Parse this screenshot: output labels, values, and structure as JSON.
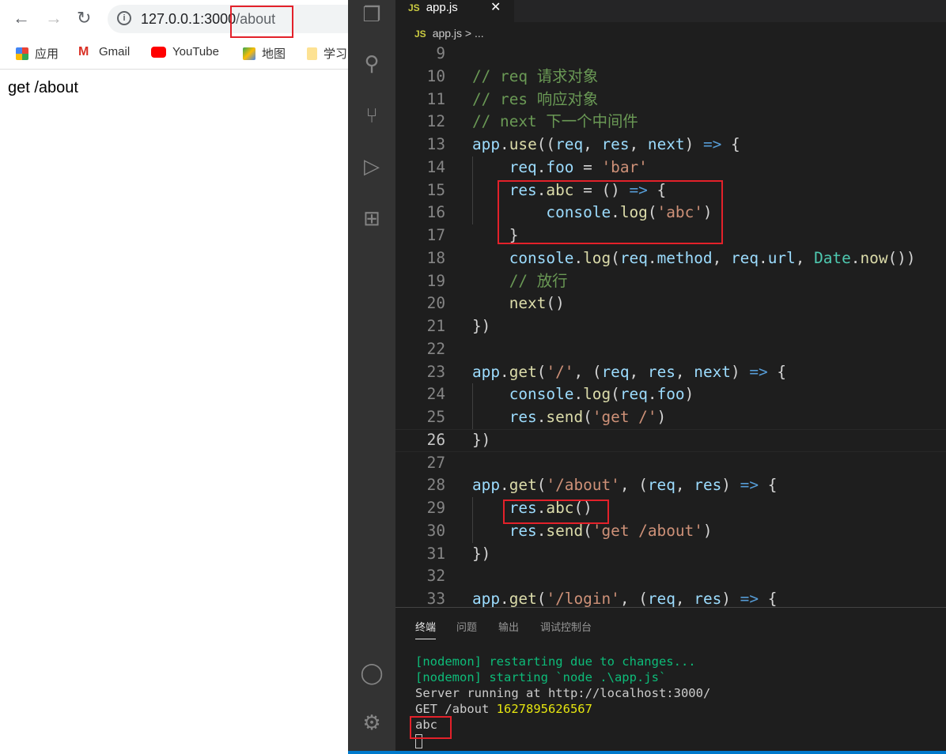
{
  "browser": {
    "url_host": "127.0.0.1:3000",
    "url_path": "/about",
    "bookmarks": [
      {
        "label": "应用",
        "icon": "apps-grid-icon"
      },
      {
        "label": "Gmail",
        "icon": "gmail-icon"
      },
      {
        "label": "YouTube",
        "icon": "youtube-icon"
      },
      {
        "label": "地图",
        "icon": "maps-icon"
      },
      {
        "label": "学习",
        "icon": "folder-icon"
      }
    ],
    "page_text": "get /about"
  },
  "editor": {
    "tab_label": "app.js",
    "tab_badge": "JS",
    "breadcrumb": "app.js > ...",
    "current_line": 26,
    "lines": [
      {
        "n": 9,
        "t": []
      },
      {
        "n": 10,
        "t": [
          [
            "cmt",
            "// req 请求对象"
          ]
        ]
      },
      {
        "n": 11,
        "t": [
          [
            "cmt",
            "// res 响应对象"
          ]
        ]
      },
      {
        "n": 12,
        "t": [
          [
            "cmt",
            "// next 下一个中间件"
          ]
        ]
      },
      {
        "n": 13,
        "t": [
          [
            "var",
            "app"
          ],
          [
            "pun",
            "."
          ],
          [
            "fn",
            "use"
          ],
          [
            "pun",
            "(("
          ],
          [
            "var",
            "req"
          ],
          [
            "pun",
            ", "
          ],
          [
            "var",
            "res"
          ],
          [
            "pun",
            ", "
          ],
          [
            "var",
            "next"
          ],
          [
            "pun",
            ") "
          ],
          [
            "kw",
            "=>"
          ],
          [
            "pun",
            " {"
          ]
        ]
      },
      {
        "n": 14,
        "t": [
          [
            "pun",
            "    "
          ],
          [
            "var",
            "req"
          ],
          [
            "pun",
            "."
          ],
          [
            "var",
            "foo"
          ],
          [
            "pun",
            " = "
          ],
          [
            "str",
            "'bar'"
          ]
        ]
      },
      {
        "n": 15,
        "t": [
          [
            "pun",
            "    "
          ],
          [
            "var",
            "res"
          ],
          [
            "pun",
            "."
          ],
          [
            "fn",
            "abc"
          ],
          [
            "pun",
            " = () "
          ],
          [
            "kw",
            "=>"
          ],
          [
            "pun",
            " {"
          ]
        ]
      },
      {
        "n": 16,
        "t": [
          [
            "pun",
            "        "
          ],
          [
            "var",
            "console"
          ],
          [
            "pun",
            "."
          ],
          [
            "fn",
            "log"
          ],
          [
            "pun",
            "("
          ],
          [
            "str",
            "'abc'"
          ],
          [
            "pun",
            ")"
          ]
        ]
      },
      {
        "n": 17,
        "t": [
          [
            "pun",
            "    }"
          ]
        ]
      },
      {
        "n": 18,
        "t": [
          [
            "pun",
            "    "
          ],
          [
            "var",
            "console"
          ],
          [
            "pun",
            "."
          ],
          [
            "fn",
            "log"
          ],
          [
            "pun",
            "("
          ],
          [
            "var",
            "req"
          ],
          [
            "pun",
            "."
          ],
          [
            "var",
            "method"
          ],
          [
            "pun",
            ", "
          ],
          [
            "var",
            "req"
          ],
          [
            "pun",
            "."
          ],
          [
            "var",
            "url"
          ],
          [
            "pun",
            ", "
          ],
          [
            "cls",
            "Date"
          ],
          [
            "pun",
            "."
          ],
          [
            "fn",
            "now"
          ],
          [
            "pun",
            "())"
          ]
        ]
      },
      {
        "n": 19,
        "t": [
          [
            "pun",
            "    "
          ],
          [
            "cmt",
            "// 放行"
          ]
        ]
      },
      {
        "n": 20,
        "t": [
          [
            "pun",
            "    "
          ],
          [
            "fn",
            "next"
          ],
          [
            "pun",
            "()"
          ]
        ]
      },
      {
        "n": 21,
        "t": [
          [
            "pun",
            "})"
          ]
        ]
      },
      {
        "n": 22,
        "t": []
      },
      {
        "n": 23,
        "t": [
          [
            "var",
            "app"
          ],
          [
            "pun",
            "."
          ],
          [
            "fn",
            "get"
          ],
          [
            "pun",
            "("
          ],
          [
            "str",
            "'/'"
          ],
          [
            "pun",
            ", ("
          ],
          [
            "var",
            "req"
          ],
          [
            "pun",
            ", "
          ],
          [
            "var",
            "res"
          ],
          [
            "pun",
            ", "
          ],
          [
            "var",
            "next"
          ],
          [
            "pun",
            ") "
          ],
          [
            "kw",
            "=>"
          ],
          [
            "pun",
            " {"
          ]
        ]
      },
      {
        "n": 24,
        "t": [
          [
            "pun",
            "    "
          ],
          [
            "var",
            "console"
          ],
          [
            "pun",
            "."
          ],
          [
            "fn",
            "log"
          ],
          [
            "pun",
            "("
          ],
          [
            "var",
            "req"
          ],
          [
            "pun",
            "."
          ],
          [
            "var",
            "foo"
          ],
          [
            "pun",
            ")"
          ]
        ]
      },
      {
        "n": 25,
        "t": [
          [
            "pun",
            "    "
          ],
          [
            "var",
            "res"
          ],
          [
            "pun",
            "."
          ],
          [
            "fn",
            "send"
          ],
          [
            "pun",
            "("
          ],
          [
            "str",
            "'get /'"
          ],
          [
            "pun",
            ")"
          ]
        ]
      },
      {
        "n": 26,
        "t": [
          [
            "pun",
            "})"
          ]
        ]
      },
      {
        "n": 27,
        "t": []
      },
      {
        "n": 28,
        "t": [
          [
            "var",
            "app"
          ],
          [
            "pun",
            "."
          ],
          [
            "fn",
            "get"
          ],
          [
            "pun",
            "("
          ],
          [
            "str",
            "'/about'"
          ],
          [
            "pun",
            ", ("
          ],
          [
            "var",
            "req"
          ],
          [
            "pun",
            ", "
          ],
          [
            "var",
            "res"
          ],
          [
            "pun",
            ") "
          ],
          [
            "kw",
            "=>"
          ],
          [
            "pun",
            " {"
          ]
        ]
      },
      {
        "n": 29,
        "t": [
          [
            "pun",
            "    "
          ],
          [
            "var",
            "res"
          ],
          [
            "pun",
            "."
          ],
          [
            "fn",
            "abc"
          ],
          [
            "pun",
            "()"
          ]
        ]
      },
      {
        "n": 30,
        "t": [
          [
            "pun",
            "    "
          ],
          [
            "var",
            "res"
          ],
          [
            "pun",
            "."
          ],
          [
            "fn",
            "send"
          ],
          [
            "pun",
            "("
          ],
          [
            "str",
            "'get /about'"
          ],
          [
            "pun",
            ")"
          ]
        ]
      },
      {
        "n": 31,
        "t": [
          [
            "pun",
            "})"
          ]
        ]
      },
      {
        "n": 32,
        "t": []
      },
      {
        "n": 33,
        "t": [
          [
            "var",
            "app"
          ],
          [
            "pun",
            "."
          ],
          [
            "fn",
            "get"
          ],
          [
            "pun",
            "("
          ],
          [
            "str",
            "'/login'"
          ],
          [
            "pun",
            ", ("
          ],
          [
            "var",
            "req"
          ],
          [
            "pun",
            ", "
          ],
          [
            "var",
            "res"
          ],
          [
            "pun",
            ") "
          ],
          [
            "kw",
            "=>"
          ],
          [
            "pun",
            " {"
          ]
        ]
      }
    ]
  },
  "panel": {
    "tabs": [
      "终端",
      "问题",
      "输出",
      "调试控制台"
    ],
    "terminal": {
      "line1": "[nodemon] restarting due to changes...",
      "line2": "[nodemon] starting `node .\\app.js`",
      "line3": "Server running at http://localhost:3000/",
      "line4_prefix": "GET /about ",
      "line4_time": "1627895626567",
      "line5": "abc"
    }
  },
  "colors": {
    "highlight_box": "#e3212a",
    "status_bar": "#007acc"
  }
}
